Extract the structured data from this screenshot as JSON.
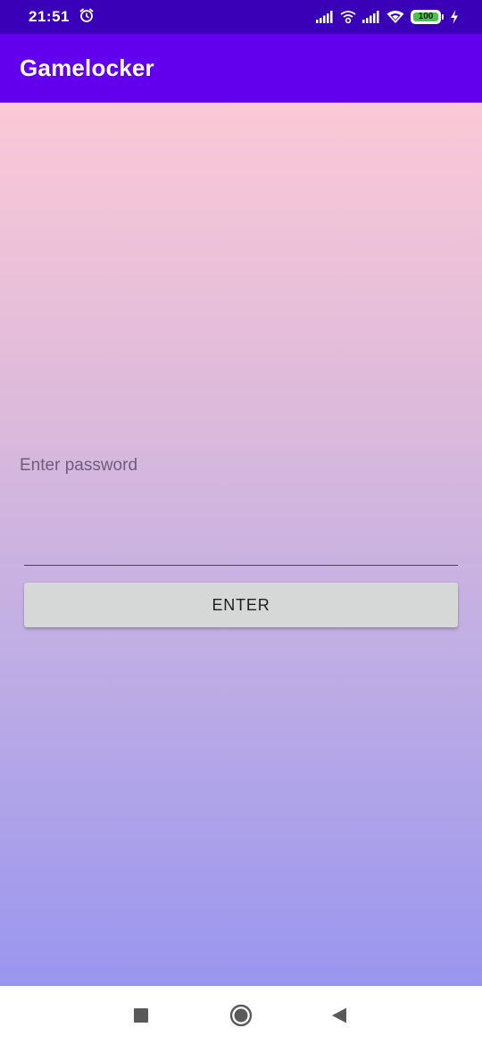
{
  "status_bar": {
    "time": "21:51",
    "battery_level": "100",
    "icons": [
      "alarm-icon",
      "signal-icon",
      "wifi-calling-icon",
      "signal-icon",
      "wifi-icon",
      "battery-icon",
      "charging-icon"
    ]
  },
  "app_bar": {
    "title": "Gamelocker"
  },
  "form": {
    "password_label": "Enter password",
    "password_value": "",
    "enter_label": "ENTER"
  },
  "nav_bar": {
    "icons": [
      "recents-icon",
      "home-icon",
      "back-icon"
    ]
  },
  "colors": {
    "status_bar": "#3a00b7",
    "app_bar": "#6200ee",
    "gradient_top": "#fbc9d7",
    "gradient_bottom": "#9a96ef",
    "button": "#d6d7d7"
  }
}
